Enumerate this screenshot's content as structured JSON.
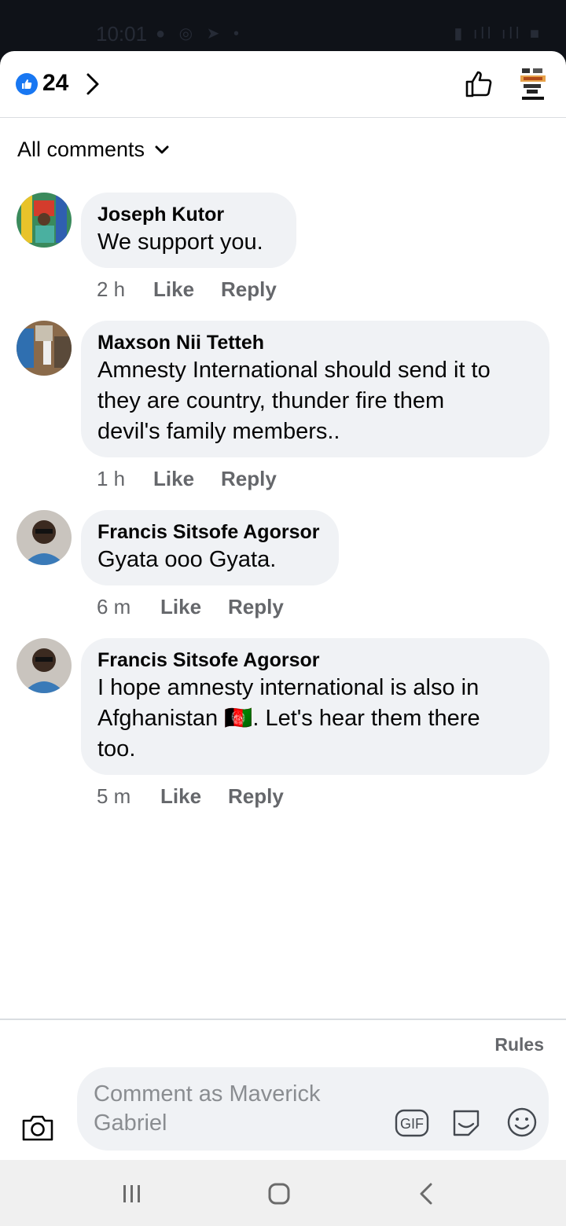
{
  "status_bar": {
    "time": "10:01"
  },
  "header": {
    "reaction_count": "24"
  },
  "filter": {
    "label": "All comments"
  },
  "comments": [
    {
      "author": "Joseph Kutor",
      "text": "We support you.",
      "time": "2 h",
      "like": "Like",
      "reply": "Reply"
    },
    {
      "author": "Maxson Nii Tetteh",
      "text_lines": [
        "Amnesty International should send it to",
        "they are country, thunder fire them",
        "devil's family members.."
      ],
      "time": "1 h",
      "like": "Like",
      "reply": "Reply"
    },
    {
      "author": "Francis Sitsofe Agorsor",
      "text": "Gyata ooo Gyata.",
      "time": "6 m",
      "like": "Like",
      "reply": "Reply"
    },
    {
      "author": "Francis Sitsofe Agorsor",
      "text_lines": [
        "I hope amnesty international is also in",
        "Afghanistan 🇦🇫. Let's hear them there",
        "too."
      ],
      "time": "5 m",
      "like": "Like",
      "reply": "Reply"
    }
  ],
  "composer": {
    "rules": "Rules",
    "placeholder_lines": [
      "Comment as Maverick",
      "Gabriel"
    ]
  },
  "colors": {
    "accent": "#1877f2",
    "bubble": "#f0f2f5",
    "meta": "#65676b"
  }
}
